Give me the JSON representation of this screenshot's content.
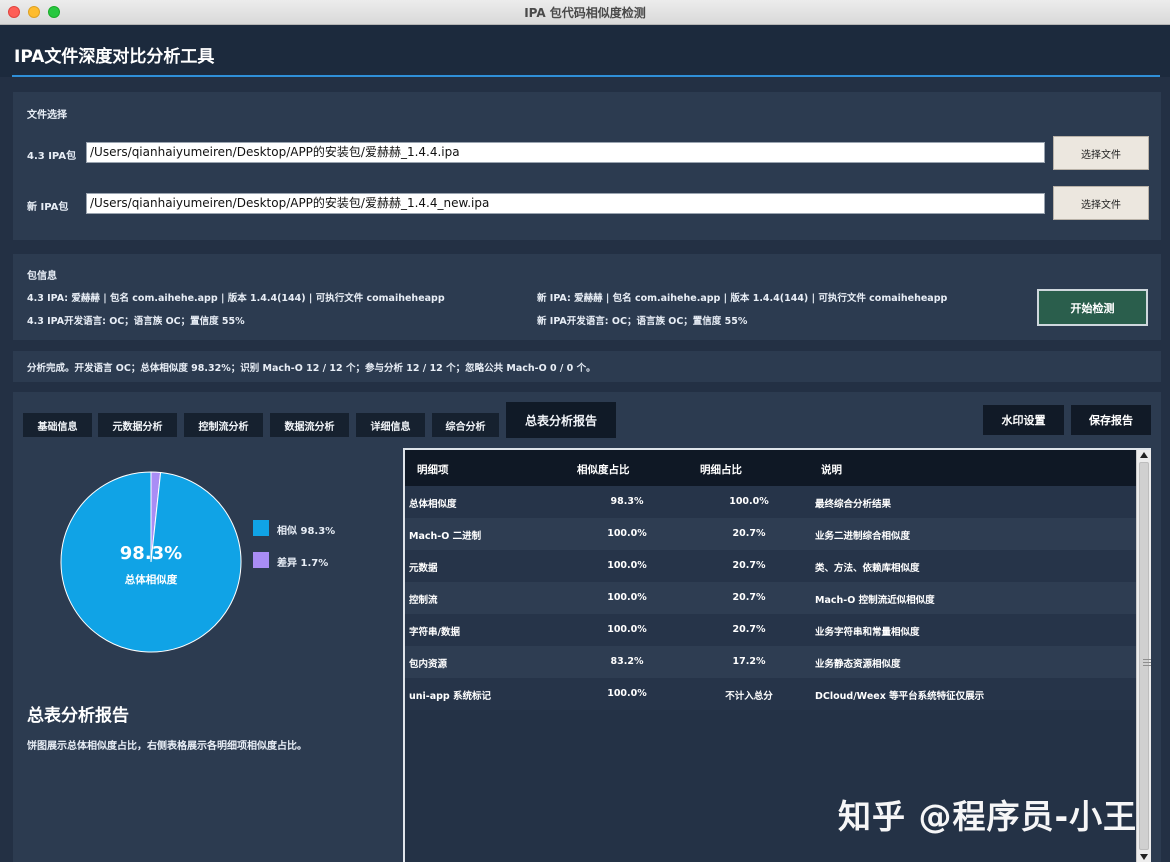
{
  "window": {
    "title": "IPA 包代码相似度检测"
  },
  "app": {
    "title": "IPA文件深度对比分析工具"
  },
  "file_select": {
    "section_label": "文件选择",
    "rows": [
      {
        "label": "4.3 IPA包",
        "value": "/Users/qianhaiyumeiren/Desktop/APP的安装包/爱赫赫_1.4.4.ipa",
        "button": "选择文件"
      },
      {
        "label": "新 IPA包",
        "value": "/Users/qianhaiyumeiren/Desktop/APP的安装包/爱赫赫_1.4.4_new.ipa",
        "button": "选择文件"
      }
    ]
  },
  "package_info": {
    "section_label": "包信息",
    "left_line1": "4.3 IPA: 爱赫赫 | 包名 com.aihehe.app | 版本 1.4.4(144) | 可执行文件 comaiheheapp",
    "left_line2": "4.3 IPA开发语言: OC；语言族 OC；置信度 55%",
    "right_line1": "新 IPA: 爱赫赫 | 包名 com.aihehe.app | 版本 1.4.4(144) | 可执行文件 comaiheheapp",
    "right_line2": "新 IPA开发语言: OC；语言族 OC；置信度 55%",
    "start_button": "开始检测"
  },
  "status": {
    "text": "分析完成。开发语言 OC；总体相似度 98.32%；识别 Mach-O 12 / 12 个；参与分析 12 / 12 个；忽略公共 Mach-O 0 / 0 个。"
  },
  "tabs": [
    {
      "label": "基础信息"
    },
    {
      "label": "元数据分析"
    },
    {
      "label": "控制流分析"
    },
    {
      "label": "数据流分析"
    },
    {
      "label": "详细信息"
    },
    {
      "label": "综合分析"
    },
    {
      "label": "总表分析报告",
      "active": true
    }
  ],
  "actions": {
    "watermark": "水印设置",
    "save": "保存报告"
  },
  "chart_data": {
    "type": "pie",
    "categories": [
      "相似",
      "差异"
    ],
    "values": [
      98.3,
      1.7
    ],
    "colors": [
      "#10a3e6",
      "#a98df5"
    ],
    "center_value": "98.3%",
    "center_label": "总体相似度",
    "legend": [
      {
        "label": "相似 98.3%",
        "color": "#10a3e6"
      },
      {
        "label": "差异 1.7%",
        "color": "#a98df5"
      }
    ],
    "legend_position": "right"
  },
  "report": {
    "title": "总表分析报告",
    "description": "饼图展示总体相似度占比，右侧表格展示各明细项相似度占比。"
  },
  "table": {
    "headers": [
      "明细项",
      "相似度占比",
      "明细占比",
      "说明"
    ],
    "rows": [
      [
        "总体相似度",
        "98.3%",
        "100.0%",
        "最终综合分析结果"
      ],
      [
        "Mach-O 二进制",
        "100.0%",
        "20.7%",
        "业务二进制综合相似度"
      ],
      [
        "元数据",
        "100.0%",
        "20.7%",
        "类、方法、依赖库相似度"
      ],
      [
        "控制流",
        "100.0%",
        "20.7%",
        "Mach-O 控制流近似相似度"
      ],
      [
        "字符串/数据",
        "100.0%",
        "20.7%",
        "业务字符串和常量相似度"
      ],
      [
        "包内资源",
        "83.2%",
        "17.2%",
        "业务静态资源相似度"
      ],
      [
        "uni-app 系统标记",
        "100.0%",
        "不计入总分",
        "DCloud/Weex 等平台系统特征仅展示"
      ]
    ]
  },
  "watermark_text": "知乎 @程序员-小王"
}
